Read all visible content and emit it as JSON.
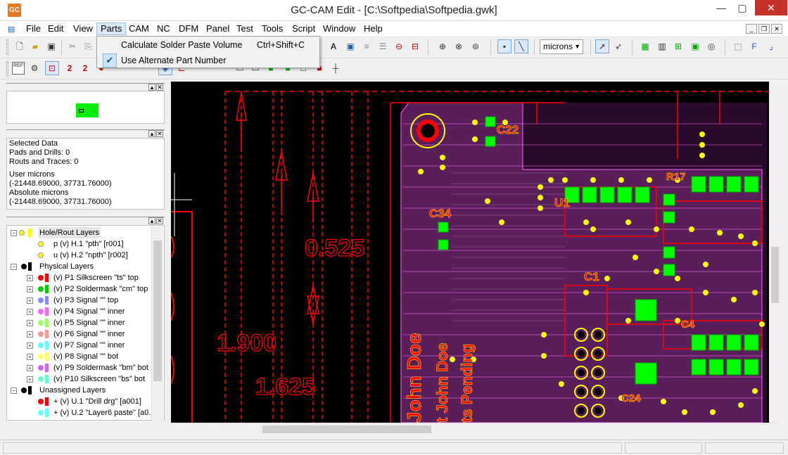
{
  "window": {
    "title": "GC-CAM Edit - [C:\\Softpedia\\Softpedia.gwk]",
    "icon_text": "GC",
    "controls": {
      "minimize": "—",
      "maximize": "▢",
      "close": "✕"
    }
  },
  "menu": {
    "items": [
      "File",
      "Edit",
      "View",
      "Parts",
      "CAM",
      "NC",
      "DFM",
      "Panel",
      "Test",
      "Tools",
      "Script",
      "Window",
      "Help"
    ],
    "active": "Parts"
  },
  "parts_menu": {
    "items": [
      {
        "label": "Calculate Solder Paste Volume",
        "shortcut": "Ctrl+Shift+C",
        "checked": false
      },
      {
        "label": "Use Alternate Part Number",
        "shortcut": "",
        "checked": true
      }
    ]
  },
  "toolbar": {
    "units": "microns"
  },
  "info": {
    "lines": [
      "Selected Data",
      "Pads and Drills: 0",
      "Routs and Traces: 0",
      "User microns",
      "(-21448.69000, 37731.76000)",
      "Absolute microns",
      "(-21448.69000, 37731.76000)"
    ]
  },
  "layers": {
    "groups": [
      {
        "name": "Hole/Rout Layers",
        "items": [
          {
            "label": "p (v) H.1 \"pth\" [r001]",
            "color": "#ffff00"
          },
          {
            "label": "u (v) H.2 \"npth\" [r002]",
            "color": "#ffff00"
          }
        ]
      },
      {
        "name": "Physical Layers",
        "items": [
          {
            "label": "(v) P1 Silkscreen \"ts\" top",
            "color": "#ff0000"
          },
          {
            "label": "(v) P2 Soldermask \"cm\" top",
            "color": "#00cc00"
          },
          {
            "label": "(v) P3 Signal \"\" top",
            "color": "#8888ff"
          },
          {
            "label": "(v) P4 Signal \"\" inner",
            "color": "#ff66ff"
          },
          {
            "label": "(v) P5 Signal \"\" inner",
            "color": "#99ff66"
          },
          {
            "label": "(v) P6 Signal \"\" inner",
            "color": "#ff9999"
          },
          {
            "label": "(v) P7 Signal \"\" inner",
            "color": "#66ffff"
          },
          {
            "label": "(v) P8 Signal \"\" bot",
            "color": "#ffff66"
          },
          {
            "label": "(v) P9 Soldermask \"bm\" bot",
            "color": "#cc66ff"
          },
          {
            "label": "(v) P10 Silkscreen \"bs\" bot",
            "color": "#66ffcc"
          }
        ]
      },
      {
        "name": "Unassigned Layers",
        "items": [
          {
            "label": "+ (v) U.1 \"Drill drg\" [a001]",
            "color": "#ff0000"
          },
          {
            "label": "+ (v) U.2 \"Layer6 paste\" [a0...",
            "color": "#66ffff"
          }
        ]
      }
    ]
  },
  "canvas": {
    "dimensions": [
      "0.525",
      "1.900",
      "1.625"
    ],
    "refdes": [
      "C22",
      "C34",
      "U1",
      "C1",
      "R17",
      "C4",
      "C24"
    ],
    "silk_text": [
      "John Doe",
      "t John Doe",
      "ts Pending"
    ],
    "colors": {
      "dimension": "#ff0000",
      "board": "#ff66ff",
      "mask": "#00ff00",
      "pad": "#ffff00"
    }
  }
}
